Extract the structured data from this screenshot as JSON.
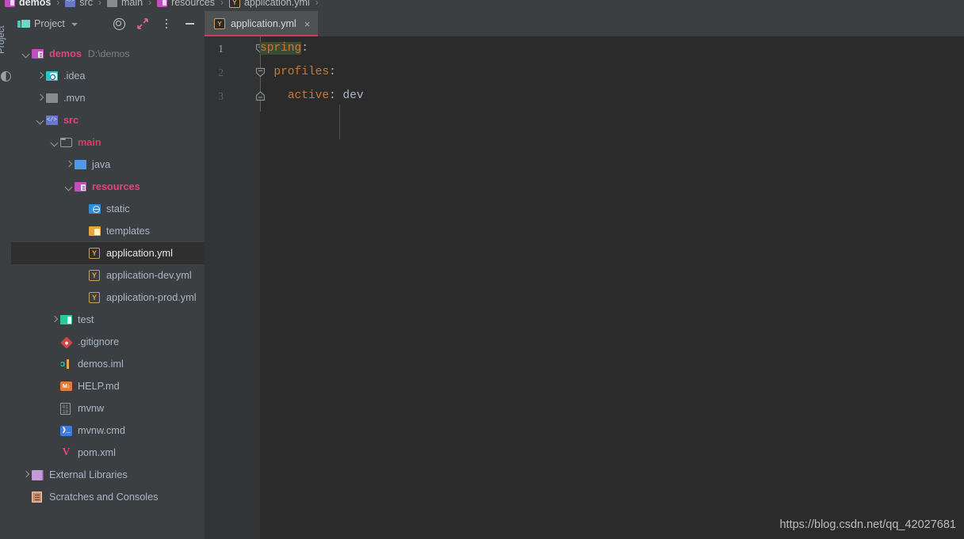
{
  "breadcrumb": {
    "items": [
      {
        "label": "demos",
        "icon": "folder-magenta-icon",
        "bold": true
      },
      {
        "label": "src",
        "icon": "source-root-icon",
        "bold": false
      },
      {
        "label": "main",
        "icon": "folder-gray-icon",
        "bold": false
      },
      {
        "label": "resources",
        "icon": "resources-folder-icon",
        "bold": false
      },
      {
        "label": "application.yml",
        "icon": "yaml-file-icon",
        "bold": false
      }
    ],
    "separator": "›"
  },
  "tool_strip": {
    "label": "Project",
    "icon": "structure-icon"
  },
  "project_panel": {
    "title": "Project",
    "title_icon": "project-folders-icon",
    "toolbar": [
      {
        "name": "select-opened-file-button",
        "icon": "target-icon",
        "tooltip": "Select Opened File"
      },
      {
        "name": "collapse-all-button",
        "icon": "collapse-all-icon",
        "tooltip": "Collapse All"
      },
      {
        "name": "options-button",
        "icon": "kebab-menu-icon",
        "tooltip": "Options"
      },
      {
        "name": "hide-button",
        "icon": "minimize-icon",
        "tooltip": "Hide"
      }
    ],
    "tree": [
      {
        "label": "demos",
        "sub": "D:\\demos",
        "depth": 0,
        "arrow": "down",
        "icon": "f-magenta",
        "icon_name": "project-folder-icon",
        "style": "magenta",
        "selected": false
      },
      {
        "label": ".idea",
        "sub": "",
        "depth": 1,
        "arrow": "right",
        "icon": "f-cyan",
        "icon_name": "idea-folder-icon",
        "style": "normal",
        "selected": false
      },
      {
        "label": ".mvn",
        "sub": "",
        "depth": 1,
        "arrow": "right",
        "icon": "f-gray",
        "icon_name": "folder-icon",
        "style": "normal",
        "selected": false
      },
      {
        "label": "src",
        "sub": "",
        "depth": 1,
        "arrow": "down",
        "icon": "f-srcblue",
        "icon_name": "source-root-folder-icon",
        "style": "magenta",
        "selected": false
      },
      {
        "label": "main",
        "sub": "",
        "depth": 2,
        "arrow": "down",
        "icon": "f-outline",
        "icon_name": "folder-outline-icon",
        "style": "crimson",
        "selected": false
      },
      {
        "label": "java",
        "sub": "",
        "depth": 3,
        "arrow": "right",
        "icon": "f-blue",
        "icon_name": "java-source-folder-icon",
        "style": "normal",
        "selected": false
      },
      {
        "label": "resources",
        "sub": "",
        "depth": 3,
        "arrow": "down",
        "icon": "f-magenta",
        "icon_name": "resources-folder-icon",
        "style": "magenta",
        "selected": false
      },
      {
        "label": "static",
        "sub": "",
        "depth": 4,
        "arrow": "none",
        "icon": "f-static",
        "icon_name": "static-folder-icon",
        "style": "normal",
        "selected": false
      },
      {
        "label": "templates",
        "sub": "",
        "depth": 4,
        "arrow": "none",
        "icon": "f-templates",
        "icon_name": "templates-folder-icon",
        "style": "normal",
        "selected": false
      },
      {
        "label": "application.yml",
        "sub": "",
        "depth": 4,
        "arrow": "none",
        "icon": "f-yml",
        "icon_name": "yaml-file-icon",
        "style": "selected-text",
        "selected": true
      },
      {
        "label": "application-dev.yml",
        "sub": "",
        "depth": 4,
        "arrow": "none",
        "icon": "f-yml",
        "icon_name": "yaml-file-icon",
        "style": "normal",
        "selected": false
      },
      {
        "label": "application-prod.yml",
        "sub": "",
        "depth": 4,
        "arrow": "none",
        "icon": "f-yml",
        "icon_name": "yaml-file-icon",
        "style": "normal",
        "selected": false
      },
      {
        "label": "test",
        "sub": "",
        "depth": 2,
        "arrow": "right",
        "icon": "f-teal",
        "icon_name": "test-folder-icon",
        "style": "normal",
        "selected": false
      },
      {
        "label": ".gitignore",
        "sub": "",
        "depth": 2,
        "arrow": "none",
        "icon": "f-git",
        "icon_name": "gitignore-file-icon",
        "style": "normal",
        "selected": false
      },
      {
        "label": "demos.iml",
        "sub": "",
        "depth": 2,
        "arrow": "none",
        "icon": "f-iml",
        "icon_name": "iml-module-file-icon",
        "style": "normal",
        "selected": false
      },
      {
        "label": "HELP.md",
        "sub": "",
        "depth": 2,
        "arrow": "none",
        "icon": "f-md",
        "icon_name": "markdown-file-icon",
        "style": "normal",
        "selected": false
      },
      {
        "label": "mvnw",
        "sub": "",
        "depth": 2,
        "arrow": "none",
        "icon": "f-sh",
        "icon_name": "shell-script-file-icon",
        "style": "normal",
        "selected": false
      },
      {
        "label": "mvnw.cmd",
        "sub": "",
        "depth": 2,
        "arrow": "none",
        "icon": "f-cmd",
        "icon_name": "cmd-script-file-icon",
        "style": "normal",
        "selected": false
      },
      {
        "label": "pom.xml",
        "sub": "",
        "depth": 2,
        "arrow": "none",
        "icon": "f-pom",
        "icon_name": "maven-pom-file-icon",
        "style": "normal",
        "selected": false
      },
      {
        "label": "External Libraries",
        "sub": "",
        "depth": 0,
        "arrow": "right",
        "icon": "f-lib",
        "icon_name": "external-libraries-icon",
        "style": "normal",
        "selected": false
      },
      {
        "label": "Scratches and Consoles",
        "sub": "",
        "depth": 0,
        "arrow": "none",
        "icon": "f-scratch",
        "icon_name": "scratches-icon",
        "style": "normal",
        "selected": false
      }
    ],
    "icon_glyphs": {
      "f-md": "M↓",
      "f-sh": "01\n10",
      "f-cmd": "❱_",
      "f-pom": "V",
      "f-iml": "ɔ",
      "f-yml": "Y"
    }
  },
  "editor": {
    "tabs": [
      {
        "label": "application.yml",
        "icon": "yaml-file-icon",
        "close": "×",
        "active": true
      }
    ],
    "line_numbers": [
      "1",
      "2",
      "3"
    ],
    "current_line": 1,
    "lines": [
      {
        "indent": "",
        "key": "spring",
        "colon": ":",
        "value": "",
        "highlight": true
      },
      {
        "indent": "  ",
        "key": "profiles",
        "colon": ":",
        "value": "",
        "highlight": false
      },
      {
        "indent": "    ",
        "key": "active",
        "colon": ":",
        "value": " dev",
        "highlight": false
      }
    ],
    "fold_markers": [
      "fold-collapse-icon",
      "fold-collapse-icon",
      "fold-end-icon"
    ]
  },
  "watermark": "https://blog.csdn.net/qq_42027681",
  "colors": {
    "panel_bg": "#3c3f41",
    "editor_bg": "#2b2b2b",
    "gutter_bg": "#313335",
    "accent_pink": "#e0335f",
    "selection_bg": "#2f2f2f",
    "selection_accent": "#9b3050",
    "yaml_key": "#cc7832",
    "yaml_value": "#a9b7c6",
    "occurrence_highlight": "#3b4a32",
    "text_default": "#a9b7c6",
    "crimson_label": "#d93a68",
    "magenta_label": "#e0457b"
  }
}
